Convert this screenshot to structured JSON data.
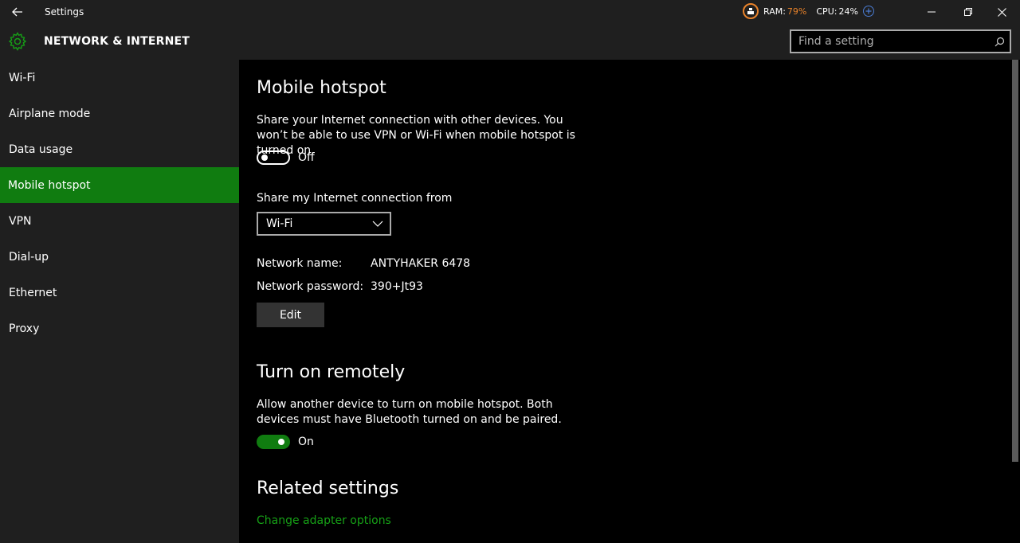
{
  "titlebar": {
    "title": "Settings",
    "sysmon": {
      "ram_label": "RAM:",
      "ram_value": "79%",
      "cpu_label": "CPU:",
      "cpu_value": "24%"
    }
  },
  "header": {
    "section_title": "NETWORK & INTERNET",
    "search_placeholder": "Find a setting"
  },
  "sidebar": {
    "items": [
      {
        "label": "Wi-Fi"
      },
      {
        "label": "Airplane mode"
      },
      {
        "label": "Data usage"
      },
      {
        "label": "Mobile hotspot",
        "active": true
      },
      {
        "label": "VPN"
      },
      {
        "label": "Dial-up"
      },
      {
        "label": "Ethernet"
      },
      {
        "label": "Proxy"
      }
    ]
  },
  "main": {
    "hotspot": {
      "title": "Mobile hotspot",
      "description": "Share your Internet connection with other devices. You won’t be able to use VPN or Wi-Fi when mobile hotspot is turned on.",
      "toggle_state": "Off"
    },
    "share_from": {
      "label": "Share my Internet connection from",
      "selected": "Wi-Fi"
    },
    "network": {
      "name_label": "Network name:",
      "name_value": "ANTYHAKER 6478",
      "password_label": "Network password:",
      "password_value": "390+Jt93",
      "edit_label": "Edit"
    },
    "remote": {
      "title": "Turn on remotely",
      "description": "Allow another device to turn on mobile hotspot. Both devices must have Bluetooth turned on and be paired.",
      "toggle_state": "On"
    },
    "related": {
      "title": "Related settings",
      "link": "Change adapter options"
    }
  },
  "colors": {
    "accent": "#107c10",
    "link": "#16a016",
    "ram_warning": "#e8822a",
    "chrome_bg": "#1f1f1f",
    "content_bg": "#000000"
  }
}
